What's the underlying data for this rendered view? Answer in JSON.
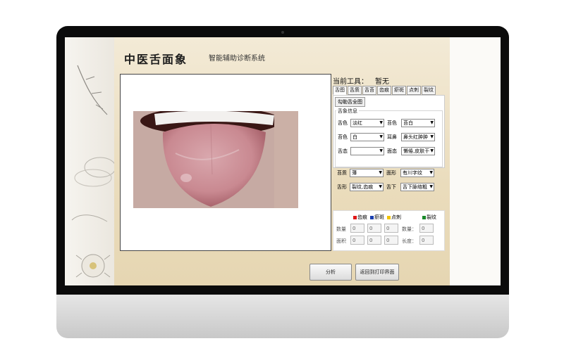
{
  "app": {
    "title": "中医舌面象",
    "subtitle": "智能辅助诊断系统"
  },
  "tool": {
    "label": "当前工具：",
    "value": "暂无"
  },
  "tabs": [
    "舌图",
    "舌质",
    "舌苔",
    "齿痕",
    "瘀斑",
    "点刺",
    "裂纹"
  ],
  "whole_button": "勾勒舌全图",
  "group_title": "舌象信息",
  "fields": {
    "r1": {
      "l1": "舌色",
      "v1": "淡红",
      "l2": "苔色",
      "v2": "苔白"
    },
    "r2": {
      "l1": "苔色",
      "v1": "白",
      "l2": "耳鼻",
      "v2": "鼻头红肿肿"
    },
    "r3": {
      "l1": "舌态",
      "v1": "",
      "l2": "面态",
      "v2": "懒倦,皮肤干"
    },
    "r4": {
      "l1": "苔质",
      "v1": "薄",
      "l2": "面形",
      "v2": "有川字纹"
    },
    "r5": {
      "l1": "舌形",
      "v1": "裂纹,齿痕",
      "l2": "舌下",
      "v2": "舌下脉络粗"
    }
  },
  "legend": {
    "l1": "齿痕",
    "l2": "瘀斑",
    "l3": "点刺",
    "l4": "裂纹",
    "c1": "#e01818",
    "c2": "#1a3fb0",
    "c3": "#f2c400",
    "c4": "#1a8a2a"
  },
  "stats": {
    "count_label": "数量",
    "area_label": "面积",
    "crack_count_label": "数量：",
    "length_label": "长度：",
    "v": "0"
  },
  "buttons": {
    "analyze": "分析",
    "back": "返回到打印界面"
  }
}
